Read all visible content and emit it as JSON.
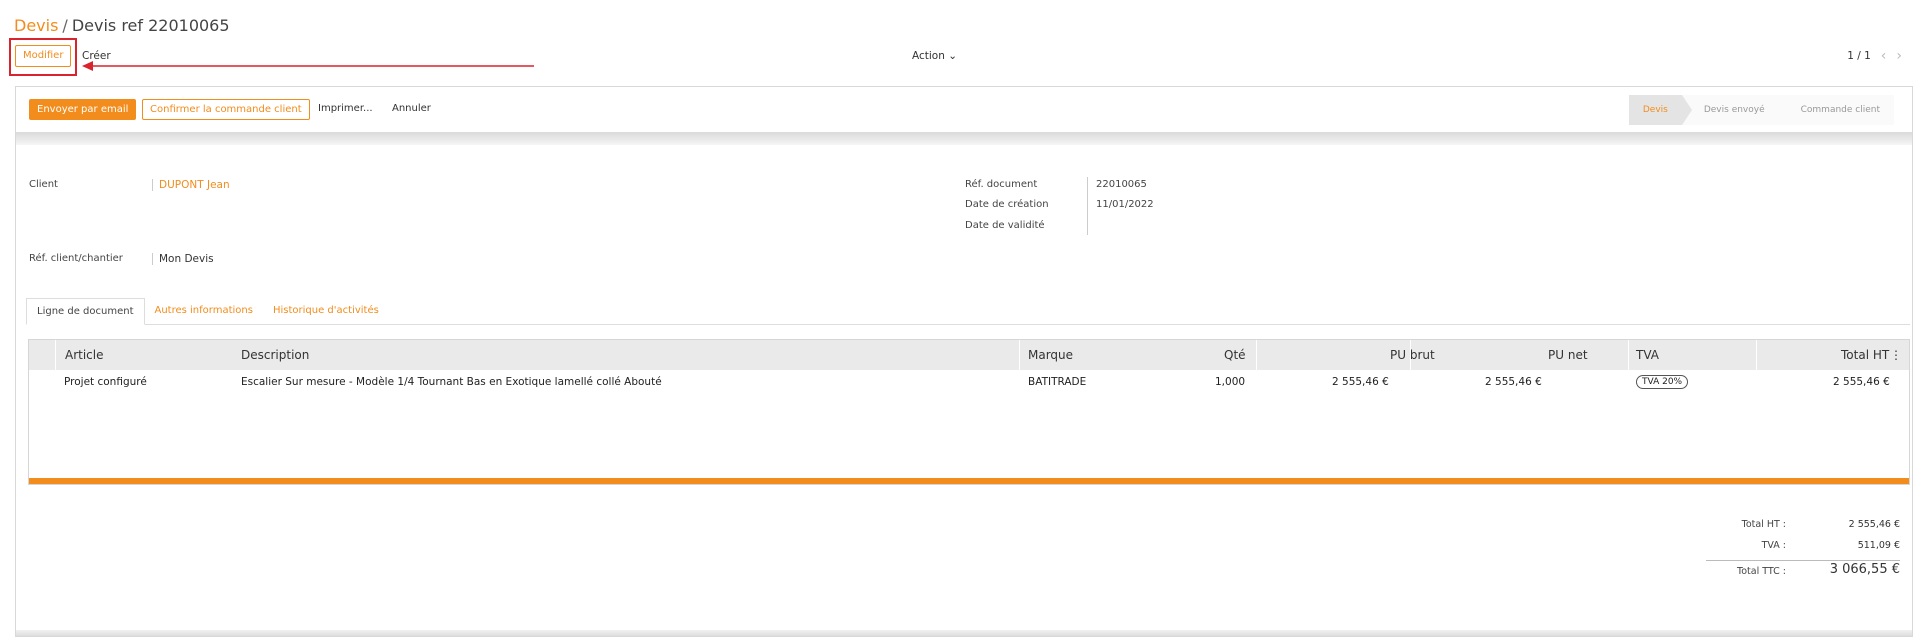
{
  "breadcrumb": {
    "parent": "Devis",
    "separator": "/",
    "current": "Devis ref 22010065"
  },
  "toolbar": {
    "edit_label": "Modifier",
    "create_label": "Créer",
    "action_label": "Action",
    "pager": "1 / 1"
  },
  "statusbar": {
    "send_email": "Envoyer par email",
    "confirm_order": "Confirmer la commande client",
    "print": "Imprimer...",
    "cancel": "Annuler",
    "stages": [
      "Devis",
      "Devis envoyé",
      "Commande client"
    ],
    "active_stage": "Devis"
  },
  "form": {
    "client_label": "Client",
    "client_value": "DUPONT Jean",
    "ref_label": "Réf. client/chantier",
    "ref_value": "Mon Devis",
    "doc_ref_label": "Réf. document",
    "doc_ref_value": "22010065",
    "created_label": "Date de création",
    "created_value": "11/01/2022",
    "validity_label": "Date de validité",
    "validity_value": ""
  },
  "tabs": [
    "Ligne de document",
    "Autres informations",
    "Historique d'activités"
  ],
  "lines": {
    "headers": [
      "Article",
      "Description",
      "Marque",
      "Qté",
      "PU brut",
      "PU net",
      "TVA",
      "Total HT"
    ],
    "rows": [
      {
        "article": "Projet configuré",
        "description": "Escalier Sur mesure - Modèle 1/4 Tournant Bas en Exotique lamellé collé Abouté",
        "marque": "BATITRADE",
        "qte": "1,000",
        "pu_brut": "2 555,46 €",
        "pu_net": "2 555,46 €",
        "tva": "TVA 20%",
        "total_ht": "2 555,46 €"
      }
    ]
  },
  "totals": {
    "ht_label": "Total HT :",
    "ht_value": "2 555,46 €",
    "tva_label": "TVA :",
    "tva_value": "511,09 €",
    "ttc_label": "Total TTC :",
    "ttc_value": "3 066,55 €"
  },
  "colors": {
    "accent": "#f28c1c",
    "highlight": "#d9232d"
  }
}
